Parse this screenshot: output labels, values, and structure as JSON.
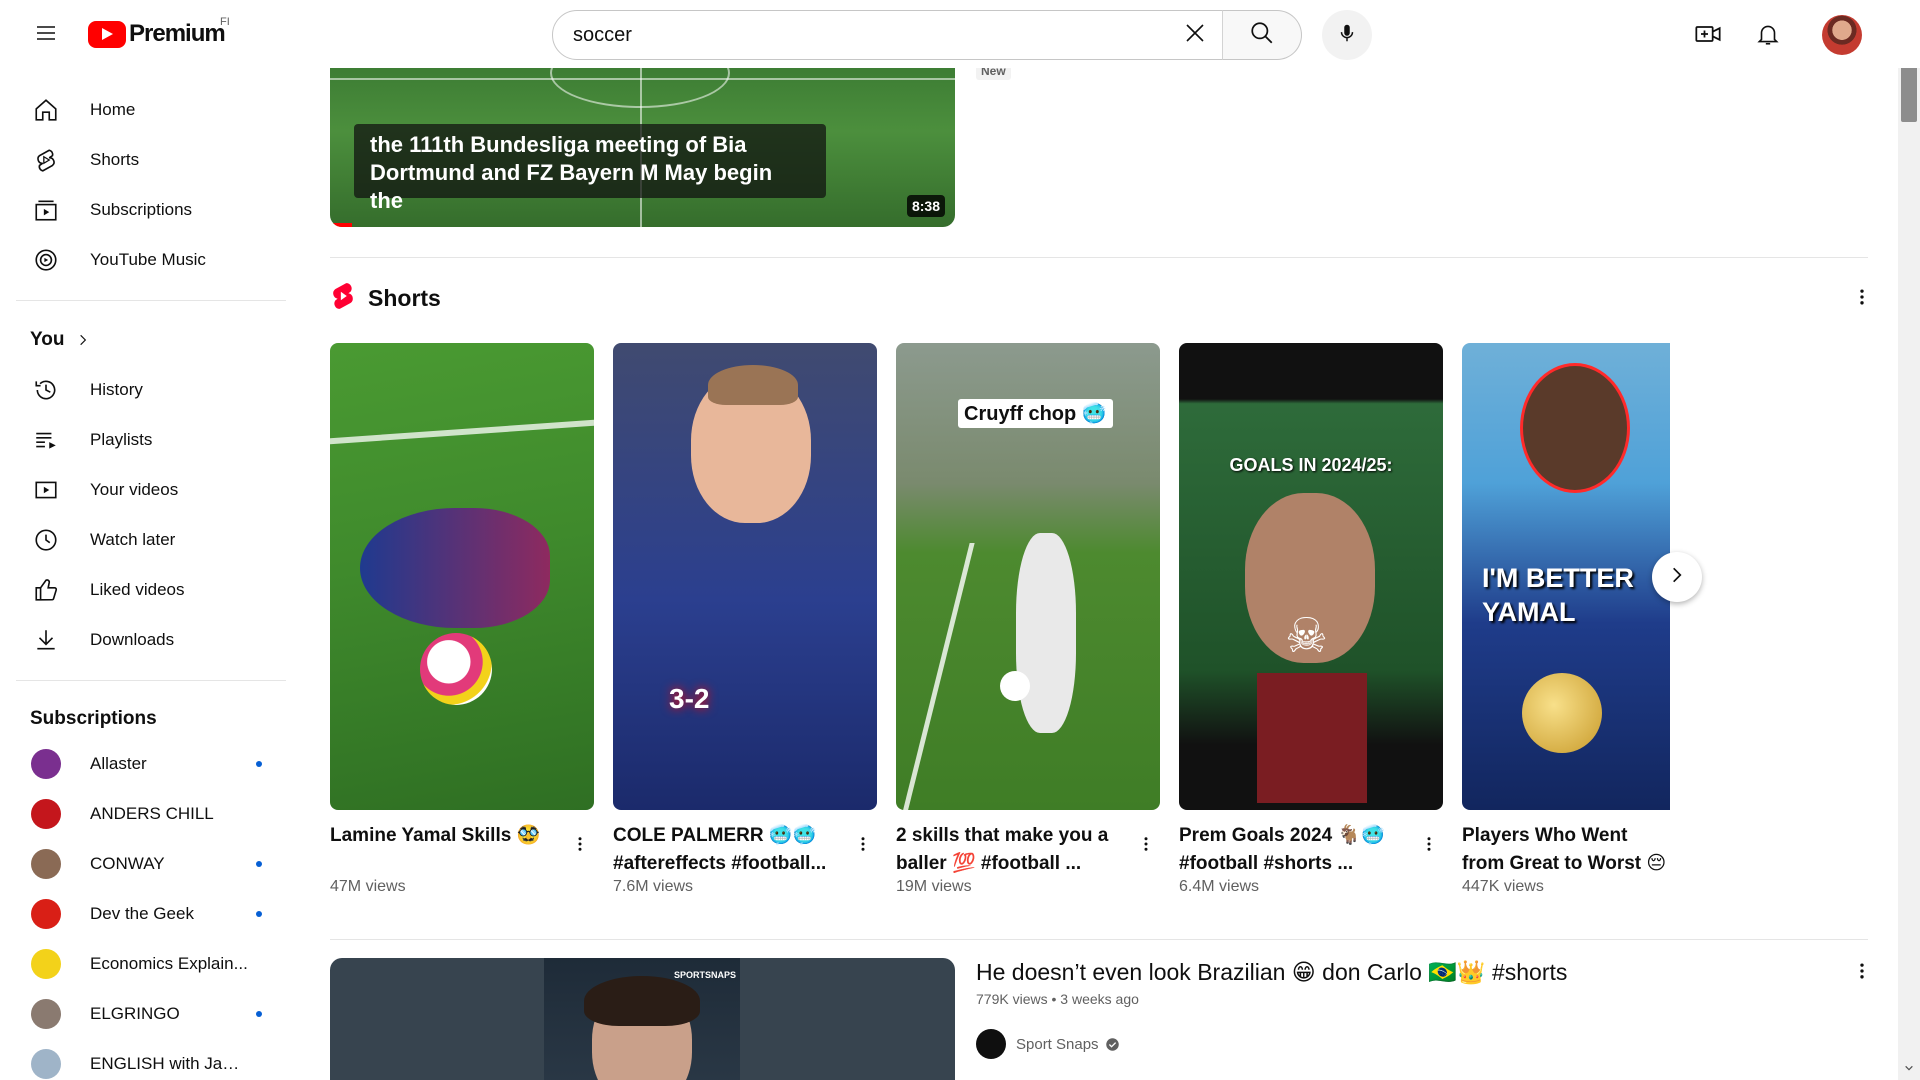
{
  "header": {
    "logo_text": "Premium",
    "country_code": "FI",
    "search_value": "soccer",
    "icons": [
      "menu-icon",
      "search-icon",
      "clear-icon",
      "mic-icon",
      "create-icon",
      "bell-icon",
      "avatar"
    ]
  },
  "sidebar": {
    "main": [
      {
        "label": "Home",
        "icon": "home-icon"
      },
      {
        "label": "Shorts",
        "icon": "shorts-icon"
      },
      {
        "label": "Subscriptions",
        "icon": "subscriptions-icon"
      },
      {
        "label": "YouTube Music",
        "icon": "music-icon"
      }
    ],
    "you_heading": "You",
    "you": [
      {
        "label": "History",
        "icon": "history-icon"
      },
      {
        "label": "Playlists",
        "icon": "playlists-icon"
      },
      {
        "label": "Your videos",
        "icon": "your-videos-icon"
      },
      {
        "label": "Watch later",
        "icon": "watch-later-icon"
      },
      {
        "label": "Liked videos",
        "icon": "like-icon"
      },
      {
        "label": "Downloads",
        "icon": "download-icon"
      }
    ],
    "subscriptions_heading": "Subscriptions",
    "subscriptions": [
      {
        "label": "Allaster",
        "new": true,
        "color": "#7a2f8f"
      },
      {
        "label": "ANDERS CHILL",
        "new": false,
        "color": "#c4161c"
      },
      {
        "label": "CONWAY",
        "new": true,
        "color": "#8a6a55"
      },
      {
        "label": "Dev the Geek",
        "new": true,
        "color": "#d91f16"
      },
      {
        "label": "Economics Explain...",
        "new": false,
        "color": "#f3d21a"
      },
      {
        "label": "ELGRINGO",
        "new": true,
        "color": "#8a7a70"
      },
      {
        "label": "ENGLISH with Jam...",
        "new": false,
        "color": "#9fb4c8"
      }
    ]
  },
  "main": {
    "top_video": {
      "caption_line1": "the 111th Bundesliga meeting of Bia",
      "caption_line2": "Dortmund and FZ Bayern M May begin the",
      "duration": "8:38",
      "badge": "New"
    },
    "shorts_heading": "Shorts",
    "shorts": [
      {
        "title": "Lamine Yamal Skills 🥸",
        "views": "47M views",
        "overlay": "",
        "colors": [
          "#3f8a2c",
          "#2f6f23"
        ]
      },
      {
        "title": "COLE PALMERR 🥶🥶 #aftereffects #football...",
        "views": "7.6M views",
        "overlay": "3-2",
        "colors": [
          "#2b3f8f",
          "#1b2a6b"
        ]
      },
      {
        "title": "2 skills that make you a baller 💯 #football ...",
        "views": "19M views",
        "overlay": "Cruyff chop 🥶",
        "colors": [
          "#8c9a6e",
          "#4d8a2f"
        ]
      },
      {
        "title": "Prem Goals 2024 🐐🥶 #football #shorts ...",
        "views": "6.4M views",
        "overlay": "GOALS IN 2024/25:",
        "colors": [
          "#2e6b3a",
          "#111111"
        ]
      },
      {
        "title": "Players Who Went from Great to Worst 😔 ...",
        "views": "447K views",
        "overlay": "I'M BETTER YAMAL",
        "colors": [
          "#4fa1d8",
          "#1f3c8a"
        ]
      }
    ],
    "bottom_video": {
      "title": "He doesn’t even look Brazilian 😁 don Carlo 🇧🇷👑 #shorts",
      "views": "779K views",
      "age": "3 weeks ago",
      "channel": "Sport Snaps",
      "thumb_text": "SPORTSNAPS"
    }
  }
}
